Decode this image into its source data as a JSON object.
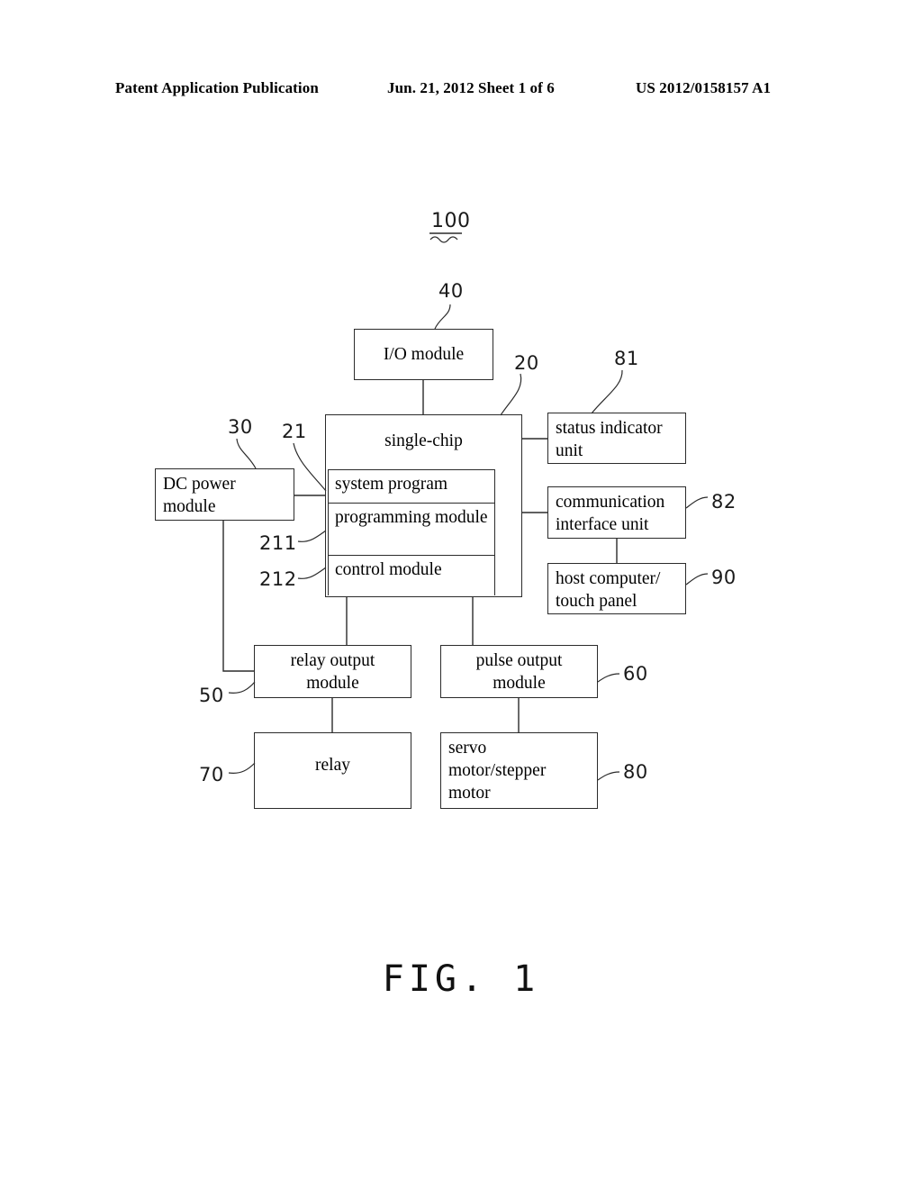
{
  "header": {
    "left": "Patent Application Publication",
    "middle": "Jun. 21, 2012  Sheet 1 of 6",
    "right": "US 2012/0158157 A1"
  },
  "figure": {
    "caption": "FIG. 1",
    "system_ref": "100"
  },
  "nodes": {
    "io_module": {
      "label": "I/O module",
      "ref": "40"
    },
    "single_chip": {
      "label": "single-chip",
      "ref": "20"
    },
    "system_program": {
      "label": "system program",
      "ref": "21"
    },
    "programming_module": {
      "label": "programming module",
      "ref": "211"
    },
    "control_module": {
      "label": "control module",
      "ref": "212"
    },
    "dc_power": {
      "label": "DC  power module",
      "ref": "30"
    },
    "status_indicator": {
      "label": "status indicator unit",
      "ref": "81"
    },
    "communication_interface": {
      "label": "communication interface unit",
      "ref": "82"
    },
    "host_computer": {
      "label": "host computer/ touch panel",
      "ref": "90"
    },
    "relay_output": {
      "label": "relay output module",
      "ref": "50"
    },
    "pulse_output": {
      "label": "pulse output module",
      "ref": "60"
    },
    "relay": {
      "label": "relay",
      "ref": "70"
    },
    "servo_motor": {
      "label": "servo motor/stepper motor",
      "ref": "80"
    }
  },
  "node_lines": {
    "dc_power_1": "DC  power",
    "dc_power_2": "module",
    "status_1": "status indicator",
    "status_2": "unit",
    "comm_1": "communication",
    "comm_2": "interface unit",
    "host_1": "host computer/",
    "host_2": "touch panel",
    "relayout_1": "relay output",
    "relayout_2": "module",
    "pulseout_1": "pulse output",
    "pulseout_2": "module",
    "servo_1": "servo",
    "servo_2": "motor/stepper",
    "servo_3": "motor",
    "progmod_1": "programming",
    "progmod_2": "module"
  },
  "connections": [
    {
      "from": "io_module",
      "to": "single_chip"
    },
    {
      "from": "dc_power",
      "to": "single_chip"
    },
    {
      "from": "dc_power",
      "to": "relay_output"
    },
    {
      "from": "single_chip",
      "to": "status_indicator"
    },
    {
      "from": "single_chip",
      "to": "communication_interface"
    },
    {
      "from": "communication_interface",
      "to": "host_computer"
    },
    {
      "from": "single_chip",
      "to": "relay_output"
    },
    {
      "from": "single_chip",
      "to": "pulse_output"
    },
    {
      "from": "relay_output",
      "to": "relay"
    },
    {
      "from": "pulse_output",
      "to": "servo_motor"
    }
  ]
}
